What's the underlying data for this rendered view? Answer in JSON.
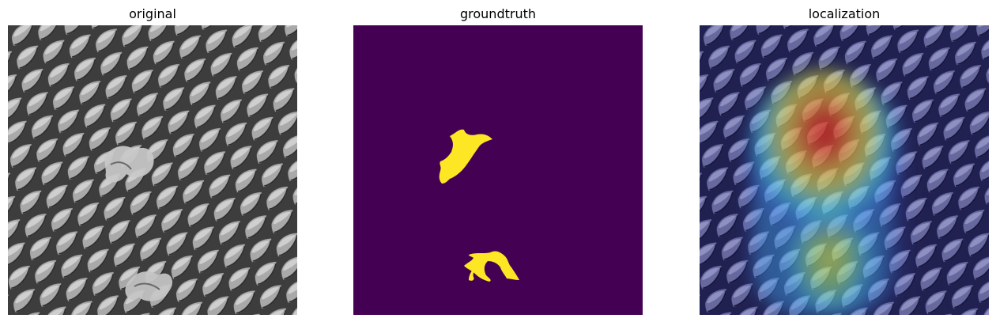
{
  "panels": [
    {
      "title": "original"
    },
    {
      "title": "groundtruth"
    },
    {
      "title": "localization"
    }
  ],
  "colors": {
    "mask_background": "#440154",
    "mask_foreground": "#fde725",
    "texture_dark": "#3a3a3a",
    "texture_light": "#b8b8b8",
    "heatmap_low": "#1a1a7a",
    "heatmap_mid": "#36c8e8",
    "heatmap_high": "#e02020"
  }
}
